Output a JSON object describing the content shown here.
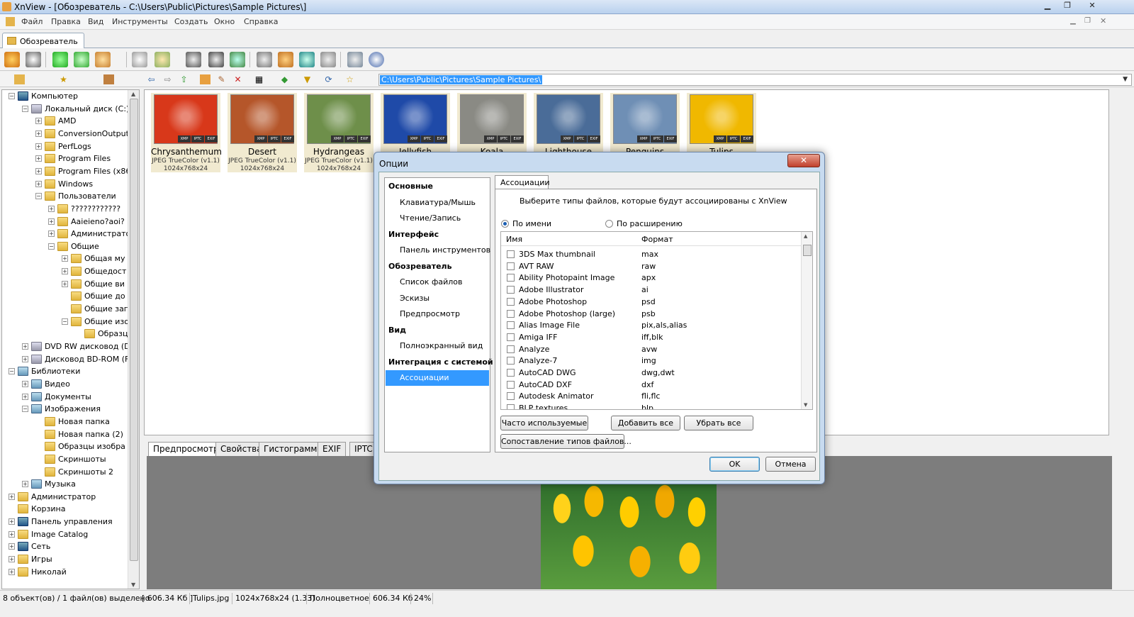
{
  "window": {
    "title": "XnView - [Обозреватель - C:\\Users\\Public\\Pictures\\Sample Pictures\\]"
  },
  "menu": [
    "Файл",
    "Правка",
    "Вид",
    "Инструменты",
    "Создать",
    "Окно",
    "Справка"
  ],
  "tab": {
    "label": "Обозреватель"
  },
  "address": {
    "path": "C:\\Users\\Public\\Pictures\\Sample Pictures\\"
  },
  "tree": [
    {
      "label": "Компьютер",
      "icon": "computer-icon"
    },
    {
      "label": "Локальный диск (C:)",
      "icon": "drive-icon"
    },
    {
      "label": "AMD",
      "icon": "folder-icon"
    },
    {
      "label": "ConversionOutput",
      "icon": "folder-icon"
    },
    {
      "label": "PerfLogs",
      "icon": "folder-icon"
    },
    {
      "label": "Program Files",
      "icon": "folder-icon"
    },
    {
      "label": "Program Files (x86",
      "icon": "folder-icon"
    },
    {
      "label": "Windows",
      "icon": "folder-icon"
    },
    {
      "label": "Пользователи",
      "icon": "folder-icon"
    },
    {
      "label": "????????????",
      "icon": "folder-icon"
    },
    {
      "label": "Aaieieno?aoi?",
      "icon": "folder-icon"
    },
    {
      "label": "Администрато",
      "icon": "folder-icon"
    },
    {
      "label": "Общие",
      "icon": "folder-icon"
    },
    {
      "label": "Общая му",
      "icon": "folder-icon"
    },
    {
      "label": "Общедост",
      "icon": "folder-icon"
    },
    {
      "label": "Общие ви",
      "icon": "folder-icon"
    },
    {
      "label": "Общие до",
      "icon": "folder-icon"
    },
    {
      "label": "Общие заг",
      "icon": "folder-icon"
    },
    {
      "label": "Общие изо",
      "icon": "folder-icon"
    },
    {
      "label": "Образц",
      "icon": "folder-icon"
    },
    {
      "label": "DVD RW дисковод (D:",
      "icon": "drive-icon"
    },
    {
      "label": "Дисковод BD-ROM (F",
      "icon": "drive-icon"
    },
    {
      "label": "Библиотеки",
      "icon": "library-icon"
    },
    {
      "label": "Видео",
      "icon": "library-icon"
    },
    {
      "label": "Документы",
      "icon": "library-icon"
    },
    {
      "label": "Изображения",
      "icon": "library-icon"
    },
    {
      "label": "Новая папка",
      "icon": "folder-icon"
    },
    {
      "label": "Новая папка (2)",
      "icon": "folder-icon"
    },
    {
      "label": "Образцы изобра",
      "icon": "folder-icon"
    },
    {
      "label": "Скриншоты",
      "icon": "folder-icon"
    },
    {
      "label": "Скриншоты 2",
      "icon": "folder-icon"
    },
    {
      "label": "Музыка",
      "icon": "library-icon"
    },
    {
      "label": "Администратор",
      "icon": "folder-icon"
    },
    {
      "label": "Корзина",
      "icon": "folder-icon"
    },
    {
      "label": "Панель управления",
      "icon": "computer-icon"
    },
    {
      "label": "Image Catalog",
      "icon": "folder-icon"
    },
    {
      "label": "Сеть",
      "icon": "computer-icon"
    },
    {
      "label": "Игры",
      "icon": "folder-icon"
    },
    {
      "label": "Николай",
      "icon": "folder-icon"
    }
  ],
  "thumbnails": [
    {
      "name": "Chrysanthemum",
      "type": "JPEG TrueColor (v1.1)",
      "dims": "1024x768x24",
      "color": "#d8381a"
    },
    {
      "name": "Desert",
      "type": "JPEG TrueColor (v1.1)",
      "dims": "1024x768x24",
      "color": "#b5562a"
    },
    {
      "name": "Hydrangeas",
      "type": "JPEG TrueColor (v1.1)",
      "dims": "1024x768x24",
      "color": "#6e8f4a"
    },
    {
      "name": "Jellyfish",
      "type": "",
      "dims": "",
      "color": "#1f4aa8"
    },
    {
      "name": "Koala",
      "type": "",
      "dims": "",
      "color": "#8a8a84"
    },
    {
      "name": "Lighthouse",
      "type": "",
      "dims": "",
      "color": "#4a6c98"
    },
    {
      "name": "Penguins",
      "type": "",
      "dims": "",
      "color": "#6f8fb5"
    },
    {
      "name": "Tulips",
      "type": "",
      "dims": "",
      "color": "#f0b800"
    }
  ],
  "thumb_badges": [
    "XMP",
    "IPTC",
    "EXIF"
  ],
  "preview_tabs": [
    "Предпросмотр",
    "Свойства",
    "Гистограмма",
    "EXIF",
    "IPTC"
  ],
  "status": {
    "selection": "8 объект(ов) / 1 файл(ов) выделено",
    "size": "[ 606.34 Кб ]",
    "file": "Tulips.jpg",
    "dims": "1024x768x24 (1.33)",
    "color_mode": "Полноцветное",
    "file_size": "606.34 Кб",
    "zoom": "24%"
  },
  "dialog": {
    "title": "Опции",
    "close": "✕",
    "categories": [
      {
        "label": "Основные",
        "kind": "h"
      },
      {
        "label": "Клавиатура/Мышь",
        "kind": "s"
      },
      {
        "label": "Чтение/Запись",
        "kind": "s"
      },
      {
        "label": "Интерфейс",
        "kind": "h"
      },
      {
        "label": "Панель инструментов",
        "kind": "s"
      },
      {
        "label": "Обозреватель",
        "kind": "h"
      },
      {
        "label": "Список файлов",
        "kind": "s"
      },
      {
        "label": "Эскизы",
        "kind": "s"
      },
      {
        "label": "Предпросмотр",
        "kind": "s"
      },
      {
        "label": "Вид",
        "kind": "h"
      },
      {
        "label": "Полноэкранный вид",
        "kind": "s"
      },
      {
        "label": "Интеграция с системой",
        "kind": "h"
      },
      {
        "label": "Ассоциации",
        "kind": "sel"
      }
    ],
    "tab": "Ассоциации",
    "description": "Выберите типы файлов, которые будут ассоциированы с XnView",
    "radio_name": "По имени",
    "radio_ext": "По расширению",
    "col_name": "Имя",
    "col_format": "Формат",
    "formats": [
      {
        "name": "3DS Max thumbnail",
        "format": "max"
      },
      {
        "name": "AVT RAW",
        "format": "raw"
      },
      {
        "name": "Ability Photopaint Image",
        "format": "apx"
      },
      {
        "name": "Adobe Illustrator",
        "format": "ai"
      },
      {
        "name": "Adobe Photoshop",
        "format": "psd"
      },
      {
        "name": "Adobe Photoshop (large)",
        "format": "psb"
      },
      {
        "name": "Alias Image File",
        "format": "pix,als,alias"
      },
      {
        "name": "Amiga IFF",
        "format": "iff,blk"
      },
      {
        "name": "Analyze",
        "format": "avw"
      },
      {
        "name": "Analyze-7",
        "format": "img"
      },
      {
        "name": "AutoCAD DWG",
        "format": "dwg,dwt"
      },
      {
        "name": "AutoCAD DXF",
        "format": "dxf"
      },
      {
        "name": "Autodesk Animator",
        "format": "fli,flc"
      },
      {
        "name": "BLP textures",
        "format": "blp"
      }
    ],
    "btn_frequent": "Часто используемые",
    "btn_add_all": "Добавить все",
    "btn_remove_all": "Убрать все",
    "btn_mapping": "Сопоставление типов файлов...",
    "btn_ok": "OK",
    "btn_cancel": "Отмена"
  }
}
